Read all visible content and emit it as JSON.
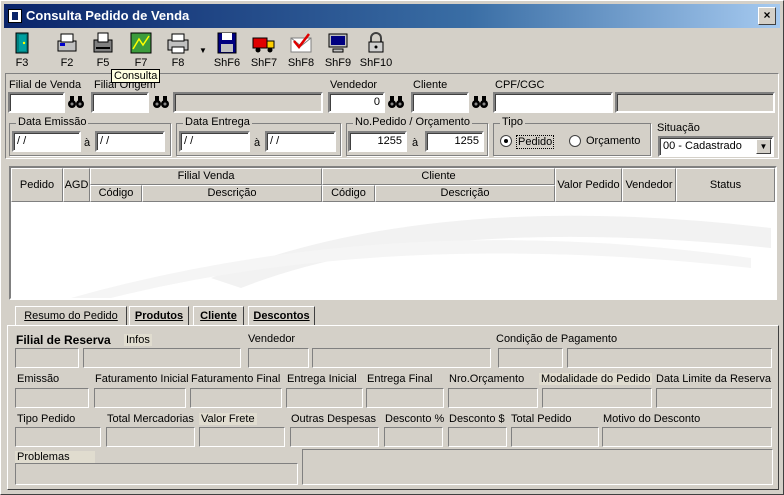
{
  "window": {
    "title": "Consulta Pedido de Venda",
    "close_label": "×"
  },
  "toolbar": {
    "buttons": [
      {
        "label": "F3",
        "icon": "exit-door-icon"
      },
      {
        "label": "F2",
        "icon": "printer-new-icon"
      },
      {
        "label": "F5",
        "icon": "fax-icon"
      },
      {
        "label": "F7",
        "icon": "map-icon"
      },
      {
        "label": "F8",
        "icon": "print-icon"
      },
      {
        "label": "ShF6",
        "icon": "save-disk-icon"
      },
      {
        "label": "ShF7",
        "icon": "truck-icon"
      },
      {
        "label": "ShF8",
        "icon": "approve-mail-icon"
      },
      {
        "label": "ShF9",
        "icon": "computer-icon"
      },
      {
        "label": "ShF10",
        "icon": "lock-icon"
      }
    ],
    "tooltip": "Consulta"
  },
  "filters": {
    "filial_venda_label": "Filial de Venda",
    "filial_origem_label": "Filial Origem",
    "vendedor_label": "Vendedor",
    "vendedor_value": "0",
    "cliente_label": "Cliente",
    "cpf_label": "CPF/CGC",
    "data_emissao_label": "Data Emissão",
    "data_emissao_de": " / /",
    "data_emissao_ate": " / /",
    "data_entrega_label": "Data Entrega",
    "data_entrega_de": " / /",
    "data_entrega_ate": " / /",
    "ate_label": "à",
    "nopedido_label": "No.Pedido / Orçamento",
    "nopedido_de": "1255",
    "nopedido_ate": "1255",
    "tipo_label": "Tipo",
    "tipo_pedido": "Pedido",
    "tipo_orcamento": "Orçamento",
    "situacao_label": "Situação",
    "situacao_value": "00 - Cadastrado"
  },
  "grid": {
    "headers": {
      "pedido": "Pedido",
      "agd": "AGD",
      "filial_venda": "Filial Venda",
      "codigo1": "Código",
      "descricao1": "Descrição",
      "cliente": "Cliente",
      "codigo2": "Código",
      "descricao2": "Descrição",
      "valor_pedido": "Valor Pedido",
      "vendedor": "Vendedor",
      "status": "Status"
    }
  },
  "tabs": [
    {
      "label": "Resumo do Pedido"
    },
    {
      "label": "Produtos"
    },
    {
      "label": "Cliente"
    },
    {
      "label": "Descontos"
    }
  ],
  "resumo": {
    "filial_reserva": "Filial de Reserva",
    "infos": "Infos",
    "vendedor": "Vendedor",
    "condicao_pagamento": "Condição de Pagamento",
    "emissao": "Emissão",
    "faturamento_inicial": "Faturamento Inicial",
    "faturamento_final": "Faturamento Final",
    "entrega_inicial": "Entrega Inicial",
    "entrega_final": "Entrega Final",
    "nro_orcamento": "Nro.Orçamento",
    "modalidade": "Modalidade do Pedido",
    "data_limite": "Data Limite da Reserva",
    "tipo_pedido": "Tipo Pedido",
    "total_mercadorias": "Total Mercadorias",
    "valor_frete": "Valor Frete",
    "outras_despesas": "Outras Despesas",
    "desconto_pct": "Desconto %",
    "desconto_val": "Desconto $",
    "total_pedido": "Total Pedido",
    "motivo_desconto": "Motivo do Desconto",
    "problemas": "Problemas"
  }
}
